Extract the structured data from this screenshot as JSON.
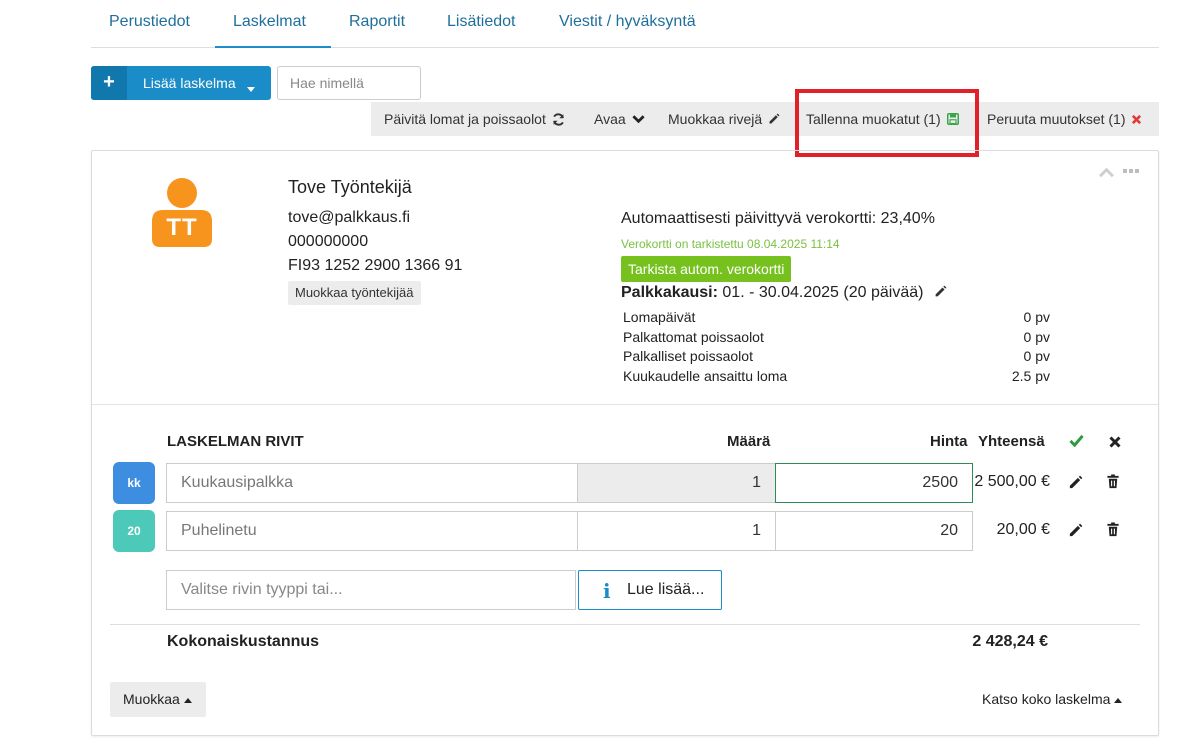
{
  "tabs": [
    {
      "label": "Perustiedot"
    },
    {
      "label": "Laskelmat"
    },
    {
      "label": "Raportit"
    },
    {
      "label": "Lisätiedot"
    },
    {
      "label": "Viestit / hyväksyntä"
    }
  ],
  "active_tab": "Laskelmat",
  "add_button": {
    "label": "Lisää laskelma"
  },
  "search": {
    "placeholder": "Hae nimellä"
  },
  "toolbar": {
    "refresh_label": "Päivitä lomat ja poissaolot",
    "open_label": "Avaa",
    "edit_rows_label": "Muokkaa rivejä",
    "save_label": "Tallenna muokatut (1)",
    "cancel_label": "Peruuta muutokset (1)"
  },
  "employee": {
    "initials": "TT",
    "name": "Tove Työntekijä",
    "email": "tove@palkkaus.fi",
    "id": "000000000",
    "iban": "FI93 1252 2900 1366 91",
    "edit_label": "Muokkaa työntekijää"
  },
  "tax": {
    "title": "Automaattisesti päivittyvä verokortti: 23,40%",
    "checked": "Verokortti on tarkistettu 08.04.2025 11:14",
    "check_button": "Tarkista autom. verokortti",
    "period_label": "Palkkakausi:",
    "period_value": "01. - 30.04.2025 (20 päivää)"
  },
  "stats": [
    {
      "label": "Lomapäivät",
      "value": "0 pv"
    },
    {
      "label": "Palkattomat poissaolot",
      "value": "0 pv"
    },
    {
      "label": "Palkalliset poissaolot",
      "value": "0 pv"
    },
    {
      "label": "Kuukaudelle ansaittu loma",
      "value": "2.5 pv"
    }
  ],
  "rows_table": {
    "heading": "LASKELMAN RIVIT",
    "qty_header": "Määrä",
    "price_header": "Hinta",
    "total_header": "Yhteensä",
    "rows": [
      {
        "badge": "kk",
        "badge_color": "#3d8de0",
        "name": "Kuukausipalkka",
        "qty": "1",
        "price": "2500",
        "total": "2 500,00 €"
      },
      {
        "badge": "20",
        "badge_color": "#4cc9b8",
        "name": "Puhelinetu",
        "qty": "1",
        "price": "20",
        "total": "20,00 €"
      }
    ],
    "type_placeholder": "Valitse rivin tyyppi tai...",
    "read_more_label": "Lue lisää..."
  },
  "summary": {
    "label": "Kokonaiskustannus",
    "value": "2 428,24 €"
  },
  "footer": {
    "edit_label": "Muokkaa",
    "full_calc_label": "Katso koko laskelma"
  },
  "colors": {
    "primary": "#1a8cc7",
    "tab_text": "#1f6f9c",
    "avatar": "#f7941e",
    "tax_green": "#76c11e",
    "highlight": "#e2202a",
    "cancel_x": "#e03b3b",
    "save_icon": "#3aa64b",
    "check": "#2e9c3e"
  }
}
